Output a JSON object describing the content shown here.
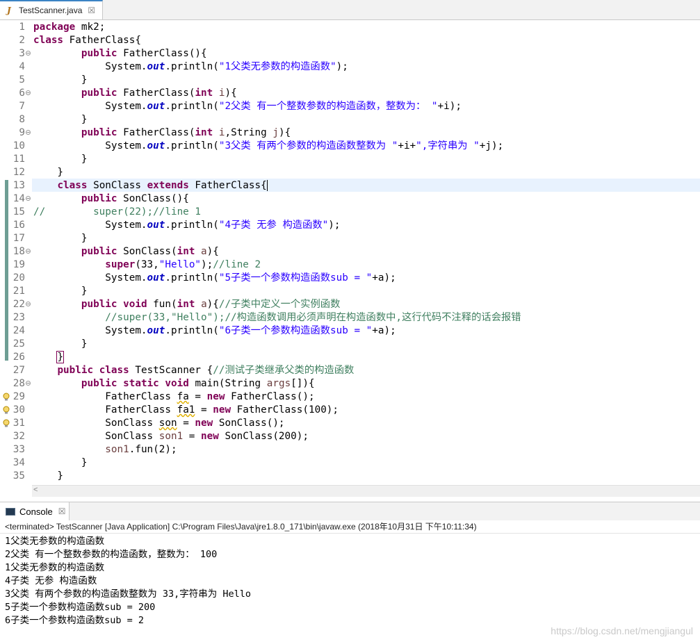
{
  "editor_tab": {
    "label": "TestScanner.java",
    "icon": "java-file-icon",
    "close": "☒"
  },
  "code": {
    "lines": [
      {
        "n": "1",
        "segs": [
          [
            "kw",
            "package"
          ],
          [
            "plain",
            " mk2;"
          ]
        ]
      },
      {
        "n": "2",
        "segs": [
          [
            "kw",
            "class"
          ],
          [
            "plain",
            " FatherClass{"
          ]
        ]
      },
      {
        "n": "3",
        "fold": true,
        "segs": [
          [
            "plain",
            "        "
          ],
          [
            "kw",
            "public"
          ],
          [
            "plain",
            " FatherClass(){"
          ]
        ]
      },
      {
        "n": "4",
        "segs": [
          [
            "plain",
            "            System."
          ],
          [
            "fld",
            "out"
          ],
          [
            "plain",
            ".println("
          ],
          [
            "str",
            "\"1父类无参数的构造函数\""
          ],
          [
            "plain",
            ");"
          ]
        ]
      },
      {
        "n": "5",
        "segs": [
          [
            "plain",
            "        }"
          ]
        ]
      },
      {
        "n": "6",
        "fold": true,
        "segs": [
          [
            "plain",
            "        "
          ],
          [
            "kw",
            "public"
          ],
          [
            "plain",
            " FatherClass("
          ],
          [
            "kw",
            "int"
          ],
          [
            "plain",
            " "
          ],
          [
            "var",
            "i"
          ],
          [
            "plain",
            "){"
          ]
        ]
      },
      {
        "n": "7",
        "segs": [
          [
            "plain",
            "            System."
          ],
          [
            "fld",
            "out"
          ],
          [
            "plain",
            ".println("
          ],
          [
            "str",
            "\"2父类 有一个整数参数的构造函数，整数为： \""
          ],
          [
            "plain",
            "+i);"
          ]
        ]
      },
      {
        "n": "8",
        "segs": [
          [
            "plain",
            "        }"
          ]
        ]
      },
      {
        "n": "9",
        "fold": true,
        "segs": [
          [
            "plain",
            "        "
          ],
          [
            "kw",
            "public"
          ],
          [
            "plain",
            " FatherClass("
          ],
          [
            "kw",
            "int"
          ],
          [
            "plain",
            " "
          ],
          [
            "var",
            "i"
          ],
          [
            "plain",
            ",String "
          ],
          [
            "var",
            "j"
          ],
          [
            "plain",
            "){"
          ]
        ]
      },
      {
        "n": "10",
        "segs": [
          [
            "plain",
            "            System."
          ],
          [
            "fld",
            "out"
          ],
          [
            "plain",
            ".println("
          ],
          [
            "str",
            "\"3父类 有两个参数的构造函数整数为 \""
          ],
          [
            "plain",
            "+i+"
          ],
          [
            "str",
            "\",字符串为 \""
          ],
          [
            "plain",
            "+j);"
          ]
        ]
      },
      {
        "n": "11",
        "segs": [
          [
            "plain",
            "        }"
          ]
        ]
      },
      {
        "n": "12",
        "segs": [
          [
            "plain",
            "    }"
          ]
        ]
      },
      {
        "n": "13",
        "current": true,
        "segs": [
          [
            "plain",
            "    "
          ],
          [
            "kw",
            "class"
          ],
          [
            "plain",
            " SonClass "
          ],
          [
            "kw",
            "extends"
          ],
          [
            "plain",
            " FatherClass{"
          ],
          [
            "caret",
            ""
          ]
        ]
      },
      {
        "n": "14",
        "fold": true,
        "segs": [
          [
            "plain",
            "        "
          ],
          [
            "kw",
            "public"
          ],
          [
            "plain",
            " SonClass(){"
          ]
        ]
      },
      {
        "n": "15",
        "segs": [
          [
            "cmt",
            "//        super(22);//line 1"
          ]
        ]
      },
      {
        "n": "16",
        "segs": [
          [
            "plain",
            "            System."
          ],
          [
            "fld",
            "out"
          ],
          [
            "plain",
            ".println("
          ],
          [
            "str",
            "\"4子类 无参 构造函数\""
          ],
          [
            "plain",
            ");"
          ]
        ]
      },
      {
        "n": "17",
        "segs": [
          [
            "plain",
            "        }"
          ]
        ]
      },
      {
        "n": "18",
        "fold": true,
        "segs": [
          [
            "plain",
            "        "
          ],
          [
            "kw",
            "public"
          ],
          [
            "plain",
            " SonClass("
          ],
          [
            "kw",
            "int"
          ],
          [
            "plain",
            " "
          ],
          [
            "var",
            "a"
          ],
          [
            "plain",
            "){"
          ]
        ]
      },
      {
        "n": "19",
        "segs": [
          [
            "plain",
            "            "
          ],
          [
            "kw",
            "super"
          ],
          [
            "plain",
            "(33,"
          ],
          [
            "str",
            "\"Hello\""
          ],
          [
            "plain",
            ");"
          ],
          [
            "cmt",
            "//line 2"
          ]
        ]
      },
      {
        "n": "20",
        "segs": [
          [
            "plain",
            "            System."
          ],
          [
            "fld",
            "out"
          ],
          [
            "plain",
            ".println("
          ],
          [
            "str",
            "\"5子类一个参数构造函数sub = \""
          ],
          [
            "plain",
            "+a);"
          ]
        ]
      },
      {
        "n": "21",
        "segs": [
          [
            "plain",
            "        }"
          ]
        ]
      },
      {
        "n": "22",
        "fold": true,
        "segs": [
          [
            "plain",
            "        "
          ],
          [
            "kw",
            "public"
          ],
          [
            "plain",
            " "
          ],
          [
            "kw",
            "void"
          ],
          [
            "plain",
            " fun("
          ],
          [
            "kw",
            "int"
          ],
          [
            "plain",
            " "
          ],
          [
            "var",
            "a"
          ],
          [
            "plain",
            "){"
          ],
          [
            "cmt",
            "//子类中定义一个实例函数"
          ]
        ]
      },
      {
        "n": "23",
        "segs": [
          [
            "plain",
            "            "
          ],
          [
            "cmt",
            "//super(33,\"Hello\");//构造函数调用必须声明在构造函数中,这行代码不注释的话会报错"
          ]
        ]
      },
      {
        "n": "24",
        "segs": [
          [
            "plain",
            "            System."
          ],
          [
            "fld",
            "out"
          ],
          [
            "plain",
            ".println("
          ],
          [
            "str",
            "\"6子类一个参数构造函数sub = \""
          ],
          [
            "plain",
            "+a);"
          ]
        ]
      },
      {
        "n": "25",
        "segs": [
          [
            "plain",
            "        }"
          ]
        ]
      },
      {
        "n": "26",
        "segs": [
          [
            "plain",
            "    "
          ],
          [
            "brace",
            "}"
          ]
        ]
      },
      {
        "n": "27",
        "segs": [
          [
            "plain",
            "    "
          ],
          [
            "kw",
            "public"
          ],
          [
            "plain",
            " "
          ],
          [
            "kw",
            "class"
          ],
          [
            "plain",
            " TestScanner {"
          ],
          [
            "cmt",
            "//测试子类继承父类的构造函数"
          ]
        ]
      },
      {
        "n": "28",
        "fold": true,
        "segs": [
          [
            "plain",
            "        "
          ],
          [
            "kw",
            "public"
          ],
          [
            "plain",
            " "
          ],
          [
            "kw",
            "static"
          ],
          [
            "plain",
            " "
          ],
          [
            "kw",
            "void"
          ],
          [
            "plain",
            " main(String "
          ],
          [
            "var",
            "args"
          ],
          [
            "plain",
            "[]){"
          ]
        ]
      },
      {
        "n": "29",
        "warn": true,
        "segs": [
          [
            "plain",
            "            FatherClass "
          ],
          [
            "unused",
            "fa"
          ],
          [
            "plain",
            " = "
          ],
          [
            "kw",
            "new"
          ],
          [
            "plain",
            " FatherClass();"
          ]
        ]
      },
      {
        "n": "30",
        "warn": true,
        "segs": [
          [
            "plain",
            "            FatherClass "
          ],
          [
            "unused",
            "fa1"
          ],
          [
            "plain",
            " = "
          ],
          [
            "kw",
            "new"
          ],
          [
            "plain",
            " FatherClass(100);"
          ]
        ]
      },
      {
        "n": "31",
        "warn": true,
        "segs": [
          [
            "plain",
            "            SonClass "
          ],
          [
            "unused",
            "son"
          ],
          [
            "plain",
            " = "
          ],
          [
            "kw",
            "new"
          ],
          [
            "plain",
            " SonClass();"
          ]
        ]
      },
      {
        "n": "32",
        "segs": [
          [
            "plain",
            "            SonClass "
          ],
          [
            "var",
            "son1"
          ],
          [
            "plain",
            " = "
          ],
          [
            "kw",
            "new"
          ],
          [
            "plain",
            " SonClass(200);"
          ]
        ]
      },
      {
        "n": "33",
        "segs": [
          [
            "plain",
            "            "
          ],
          [
            "var",
            "son1"
          ],
          [
            "plain",
            ".fun(2);"
          ]
        ]
      },
      {
        "n": "34",
        "segs": [
          [
            "plain",
            "        }"
          ]
        ]
      },
      {
        "n": "35",
        "segs": [
          [
            "plain",
            "    }"
          ]
        ]
      }
    ]
  },
  "console": {
    "tab_label": "Console",
    "close": "☒",
    "status": "<terminated> TestScanner [Java Application] C:\\Program Files\\Java\\jre1.8.0_171\\bin\\javaw.exe (2018年10月31日 下午10:11:34)",
    "output": [
      "1父类无参数的构造函数",
      "2父类 有一个整数参数的构造函数，整数为： 100",
      "1父类无参数的构造函数",
      "4子类 无参 构造函数",
      "3父类 有两个参数的构造函数整数为 33,字符串为 Hello",
      "5子类一个参数构造函数sub = 200",
      "6子类一个参数构造函数sub = 2"
    ]
  },
  "watermark": "https://blog.csdn.net/mengjiangul"
}
